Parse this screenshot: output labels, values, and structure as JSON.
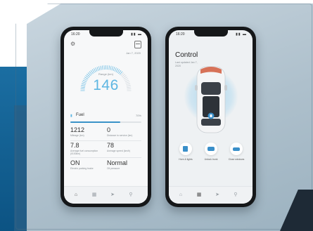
{
  "left_phone": {
    "status_time": "16:20",
    "date": "Jan 7, 2020",
    "speed_label": "Range (km)",
    "speed_value": "146",
    "fuel_label": "Fuel",
    "fuel_percent_text": "70%",
    "fuel_percent": 0.7,
    "stats": [
      {
        "value": "1212",
        "desc": "Mileage (km)"
      },
      {
        "value": "0",
        "desc": "Distance to service (km)"
      },
      {
        "value": "7.8",
        "desc": "Average fuel consumption (l/100km)"
      },
      {
        "value": "78",
        "desc": "Average speed (km/h)"
      },
      {
        "value": "ON",
        "desc": "Electric parking brake"
      },
      {
        "value": "Normal",
        "desc": "Oil pressure"
      }
    ]
  },
  "right_phone": {
    "status_time": "16:20",
    "title": "Control",
    "subtitle": "Last updated Jan 7, 2020",
    "actions": [
      {
        "label": "Horn & lights",
        "icon": "horn-lights-icon"
      },
      {
        "label": "Unlock trunk",
        "icon": "trunk-icon"
      },
      {
        "label": "Close windows",
        "icon": "car-window-icon"
      }
    ]
  },
  "colors": {
    "accent": "#5db6e2",
    "brand_blue": "#1b6ea2",
    "background": "#b6c6d1"
  }
}
